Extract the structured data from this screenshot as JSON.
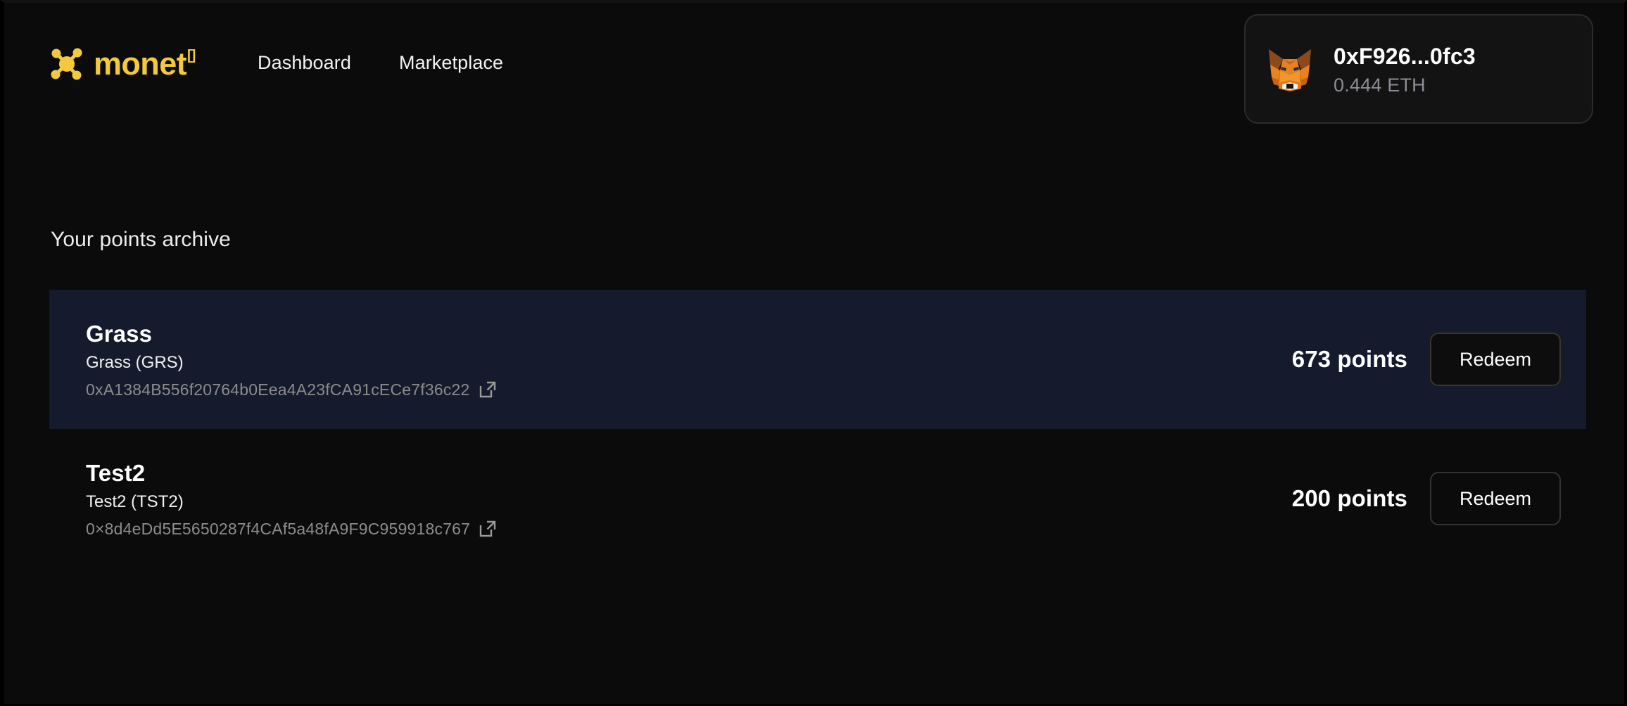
{
  "brand": {
    "name": "monet",
    "superscript": "[]",
    "logo_icon": "molecule-icon",
    "accent_color": "#f5c93c"
  },
  "nav": {
    "items": [
      {
        "label": "Dashboard",
        "name": "nav-link-dashboard"
      },
      {
        "label": "Marketplace",
        "name": "nav-link-marketplace"
      }
    ]
  },
  "wallet": {
    "avatar_icon": "metamask-fox-icon",
    "address": "0xF926...0fc3",
    "balance": "0.444 ETH"
  },
  "main": {
    "section_title": "Your points archive",
    "rows": [
      {
        "name": "Grass",
        "symbol": "Grass (GRS)",
        "address": "0xA1384B556f20764b0Eea4A23fCA91cECe7f36c22",
        "external_link_icon": "external-link-icon",
        "points": "673 points",
        "redeem_label": "Redeem",
        "highlighted": true
      },
      {
        "name": "Test2",
        "symbol": "Test2 (TST2)",
        "address": "0×8d4eDd5E5650287f4CAf5a48fA9F9C959918c767",
        "external_link_icon": "external-link-icon",
        "points": "200 points",
        "redeem_label": "Redeem",
        "highlighted": false
      }
    ]
  },
  "colors": {
    "background": "#0b0b0b",
    "highlight_row": "#151b2c",
    "accent": "#f5c93c",
    "muted_text": "#8c8c8c"
  }
}
